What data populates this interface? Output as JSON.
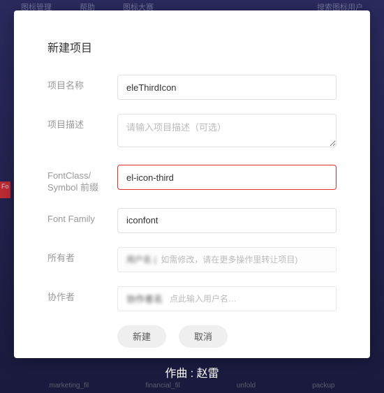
{
  "modal": {
    "title": "新建项目",
    "fields": {
      "projectName": {
        "label": "项目名称",
        "value": "eleThirdIcon"
      },
      "projectDesc": {
        "label": "项目描述",
        "placeholder": "请输入项目描述（可选）",
        "value": ""
      },
      "fontClass": {
        "label": "FontClass/ Symbol 前缀",
        "value": "el-icon-third"
      },
      "fontFamily": {
        "label": "Font Family",
        "value": "iconfont"
      },
      "owner": {
        "label": "所有者",
        "hint": "如需修改，请在更多操作里转让项目)"
      },
      "collaborator": {
        "label": "协作者",
        "placeholder": "点此输入用户名…"
      }
    },
    "buttons": {
      "create": "新建",
      "cancel": "取消"
    }
  },
  "background": {
    "topNav": [
      "图标管理",
      "帮助",
      "图标大赛",
      "搜索图标用户"
    ],
    "bottomItems": [
      "marketing_fil",
      "financial_fil",
      "unfold",
      "packup"
    ]
  },
  "musicBar": {
    "text": "作曲 : 赵雷"
  }
}
